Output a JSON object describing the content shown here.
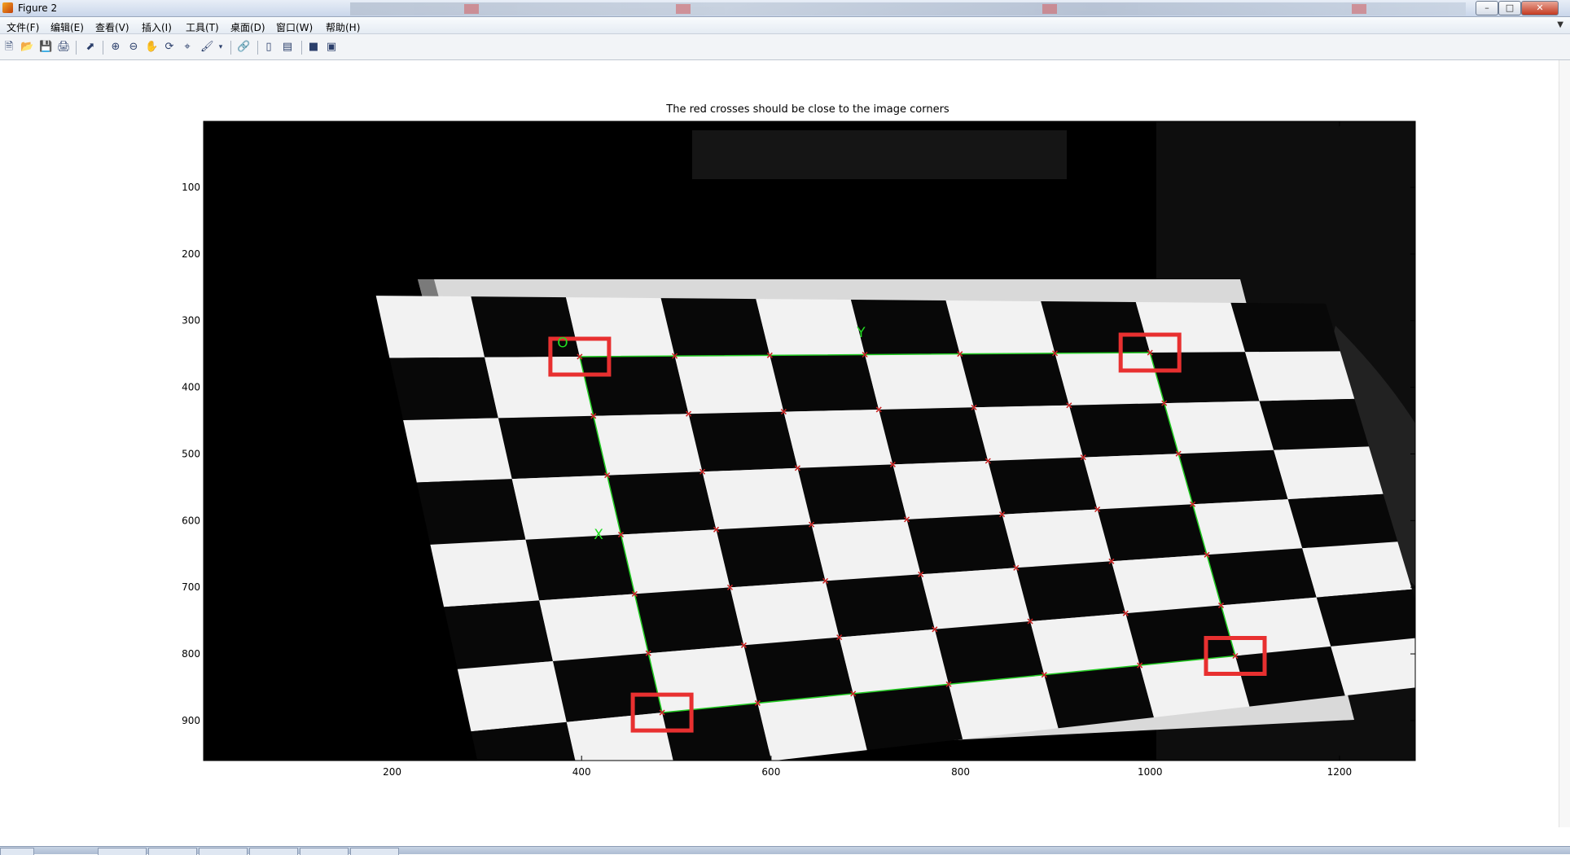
{
  "window": {
    "title": "Figure 2",
    "buttons": {
      "minimize": "–",
      "maximize": "□",
      "close": "✕"
    }
  },
  "menu": {
    "items": [
      "文件(F)",
      "编辑(E)",
      "查看(V)",
      "插入(I)",
      "工具(T)",
      "桌面(D)",
      "窗口(W)",
      "帮助(H)"
    ],
    "overflow_icon": "chevron-down-icon"
  },
  "toolbar": {
    "icons": [
      "new-figure-icon",
      "open-file-icon",
      "save-icon",
      "print-icon",
      "edit-plot-arrow-icon",
      "zoom-in-icon",
      "zoom-out-icon",
      "pan-hand-icon",
      "rotate-3d-icon",
      "data-cursor-icon",
      "brush-icon",
      "brush-dropdown-icon",
      "link-plot-icon",
      "insert-colorbar-icon",
      "insert-legend-icon",
      "hide-plot-tools-icon",
      "show-plot-tools-icon"
    ]
  },
  "chart_data": {
    "type": "image",
    "title": "The red crosses should be close to the image corners",
    "xlim": [
      1,
      1280
    ],
    "ylim": [
      1,
      960
    ],
    "y_reversed": true,
    "x_ticks": [
      200,
      400,
      600,
      800,
      1000,
      1200
    ],
    "y_ticks": [
      100,
      200,
      300,
      400,
      500,
      600,
      700,
      800,
      900
    ],
    "image_description_colors": {
      "background": "#000000",
      "light": "#f2f2f2",
      "dark": "#080808"
    },
    "annotations": [
      {
        "text": "O",
        "x": 380,
        "y": 340,
        "color": "#22dd22"
      },
      {
        "text": "Y",
        "x": 695,
        "y": 325,
        "color": "#22dd22"
      },
      {
        "text": "X",
        "x": 418,
        "y": 628,
        "color": "#22dd22"
      }
    ],
    "grid_outline_corners": [
      [
        398,
        354
      ],
      [
        1000,
        348
      ],
      [
        1090,
        803
      ],
      [
        485,
        888
      ]
    ],
    "highlight_boxes": [
      {
        "x": 398,
        "y": 354
      },
      {
        "x": 1000,
        "y": 348
      },
      {
        "x": 1090,
        "y": 803
      },
      {
        "x": 485,
        "y": 888
      }
    ],
    "marker_color": "#cc2222",
    "box_color": "#e83030",
    "line_color": "#22cc22"
  }
}
